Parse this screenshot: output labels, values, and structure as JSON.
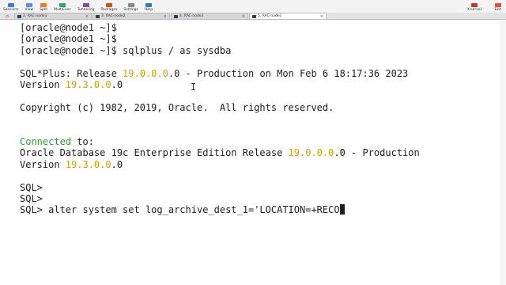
{
  "toolbar": {
    "left_items": [
      {
        "label": "Sessions",
        "icon": "sessions-icon",
        "color": "#3a7bd5"
      },
      {
        "label": "View",
        "icon": "view-icon",
        "color": "#5b8def"
      },
      {
        "label": "Split",
        "icon": "split-icon",
        "color": "#e67e22"
      },
      {
        "label": "MultiExec",
        "icon": "multiexec-icon",
        "color": "#27ae60"
      },
      {
        "label": "Tunneling",
        "icon": "tunneling-icon",
        "color": "#8e44ad"
      },
      {
        "label": "Packages",
        "icon": "packages-icon",
        "color": "#d35400"
      },
      {
        "label": "Settings",
        "icon": "settings-icon",
        "color": "#7f8c8d"
      },
      {
        "label": "Help",
        "icon": "help-icon",
        "color": "#2980b9"
      }
    ],
    "right_items": [
      {
        "label": "X server",
        "icon": "x-server-icon",
        "color": "#c0392b"
      },
      {
        "label": "Exit",
        "icon": "exit-icon",
        "color": "#e74c3c"
      }
    ]
  },
  "tabs": [
    {
      "label": "2. RAC-node1",
      "active": false
    },
    {
      "label": "3. RAC-node2",
      "active": false
    },
    {
      "label": "4. RAC-node1",
      "active": false
    },
    {
      "label": "5. RAC-node1",
      "active": true
    }
  ],
  "terminal": {
    "lines": [
      {
        "segments": [
          {
            "text": "[oracle@node1 ~]$",
            "style": "normal"
          }
        ]
      },
      {
        "segments": [
          {
            "text": "[oracle@node1 ~]$",
            "style": "normal"
          }
        ]
      },
      {
        "segments": [
          {
            "text": "[oracle@node1 ~]$ sqlplus / as sysdba",
            "style": "normal"
          }
        ]
      },
      {
        "segments": []
      },
      {
        "segments": [
          {
            "text": "SQL*Plus: Release ",
            "style": "normal"
          },
          {
            "text": "19.0.0.0",
            "style": "version"
          },
          {
            "text": ".0 - Production on Mon Feb 6 18:17:36 2023",
            "style": "normal"
          }
        ]
      },
      {
        "segments": [
          {
            "text": "Version ",
            "style": "normal"
          },
          {
            "text": "19.3.0.0",
            "style": "version"
          },
          {
            "text": ".0",
            "style": "normal"
          }
        ]
      },
      {
        "segments": []
      },
      {
        "segments": [
          {
            "text": "Copyright (c) 1982, 2019, Oracle.  All rights reserved.",
            "style": "normal"
          }
        ]
      },
      {
        "segments": []
      },
      {
        "segments": []
      },
      {
        "segments": [
          {
            "text": "Connected",
            "style": "connected"
          },
          {
            "text": " to:",
            "style": "normal"
          }
        ]
      },
      {
        "segments": [
          {
            "text": "Oracle Database 19c Enterprise Edition Release ",
            "style": "normal"
          },
          {
            "text": "19.0.0.0",
            "style": "version"
          },
          {
            "text": ".0 - Production",
            "style": "normal"
          }
        ]
      },
      {
        "segments": [
          {
            "text": "Version ",
            "style": "normal"
          },
          {
            "text": "19.3.0.0",
            "style": "version"
          },
          {
            "text": ".0",
            "style": "normal"
          }
        ]
      },
      {
        "segments": []
      },
      {
        "segments": [
          {
            "text": "SQL>",
            "style": "normal"
          }
        ]
      },
      {
        "segments": [
          {
            "text": "SQL>",
            "style": "normal"
          }
        ]
      },
      {
        "segments": [
          {
            "text": "SQL> alter system set log_archive_dest_1='LOCATION=+RECO",
            "style": "normal"
          }
        ],
        "cursor": true
      }
    ]
  },
  "colors": {
    "version_highlight": "#c8a400",
    "connected_highlight": "#2c9c2c",
    "terminal_text": "#1e1e1e",
    "terminal_background": "#ffffff"
  }
}
